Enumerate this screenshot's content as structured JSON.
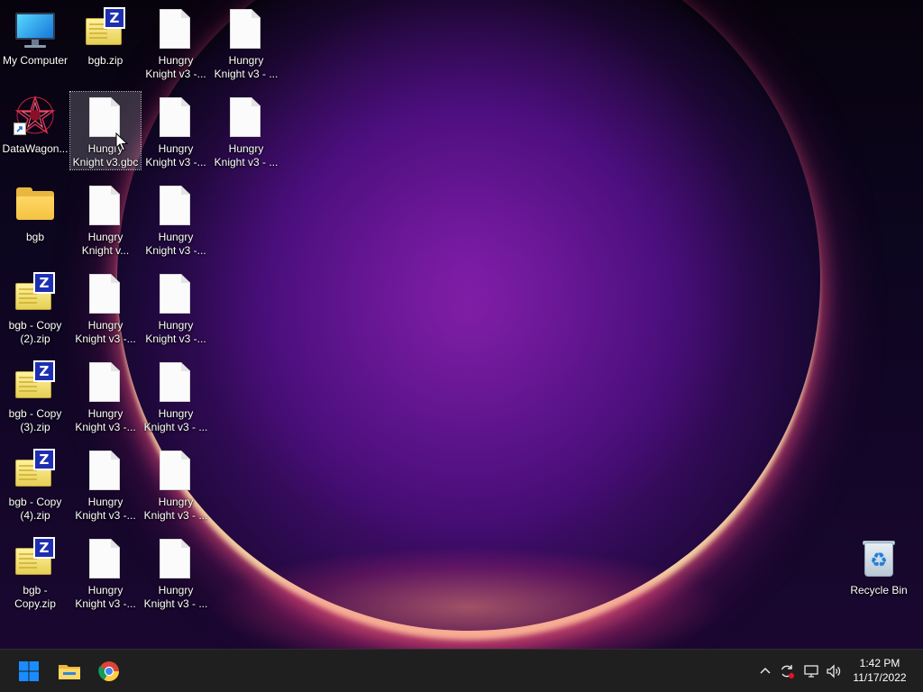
{
  "desktop": {
    "icons": [
      {
        "label": "My Computer",
        "type": "computer"
      },
      {
        "label": "bgb.zip",
        "type": "zip"
      },
      {
        "label": "Hungry Knight v3 -...",
        "type": "document"
      },
      {
        "label": "Hungry Knight v3 - ...",
        "type": "document"
      },
      {
        "label": "DataWagon...",
        "type": "datawagon-shortcut"
      },
      {
        "label": "Hungry Knight v3.gbc",
        "type": "document",
        "selected": true
      },
      {
        "label": "Hungry Knight v3 -...",
        "type": "document"
      },
      {
        "label": "Hungry Knight v3 - ...",
        "type": "document"
      },
      {
        "label": "bgb",
        "type": "folder"
      },
      {
        "label": "Hungry Knight v...",
        "type": "document"
      },
      {
        "label": "Hungry Knight v3 -...",
        "type": "document"
      },
      {
        "label": "bgb - Copy (2).zip",
        "type": "zip"
      },
      {
        "label": "Hungry Knight v3 -...",
        "type": "document"
      },
      {
        "label": "Hungry Knight v3 -...",
        "type": "document"
      },
      {
        "label": "bgb - Copy (3).zip",
        "type": "zip"
      },
      {
        "label": "Hungry Knight v3 -...",
        "type": "document"
      },
      {
        "label": "Hungry Knight v3 - ...",
        "type": "document"
      },
      {
        "label": "bgb - Copy (4).zip",
        "type": "zip"
      },
      {
        "label": "Hungry Knight v3 -...",
        "type": "document"
      },
      {
        "label": "Hungry Knight v3 - ...",
        "type": "document"
      },
      {
        "label": "bgb - Copy.zip",
        "type": "zip"
      },
      {
        "label": "Hungry Knight v3 -...",
        "type": "document"
      },
      {
        "label": "Hungry Knight v3 - ...",
        "type": "document"
      },
      {
        "label": "Recycle Bin",
        "type": "recycle-bin"
      }
    ],
    "zip_badge_letter": "Z"
  },
  "taskbar": {
    "items": [
      {
        "name": "start-button",
        "icon": "windows-logo-icon"
      },
      {
        "name": "file-explorer-button",
        "icon": "folder-icon"
      },
      {
        "name": "chrome-button",
        "icon": "chrome-icon"
      }
    ],
    "tray": {
      "overflow_icon": "chevron-up-icon",
      "icons": [
        "sync-icon",
        "network-icon",
        "volume-icon"
      ]
    },
    "clock": {
      "time": "1:42 PM",
      "date": "11/17/2022"
    }
  },
  "colors": {
    "taskbar_bg": "#1f1f1f",
    "zip_badge": "#1d2fb0",
    "folder": "#f4c242",
    "windows_blue": "#0a84ff"
  }
}
